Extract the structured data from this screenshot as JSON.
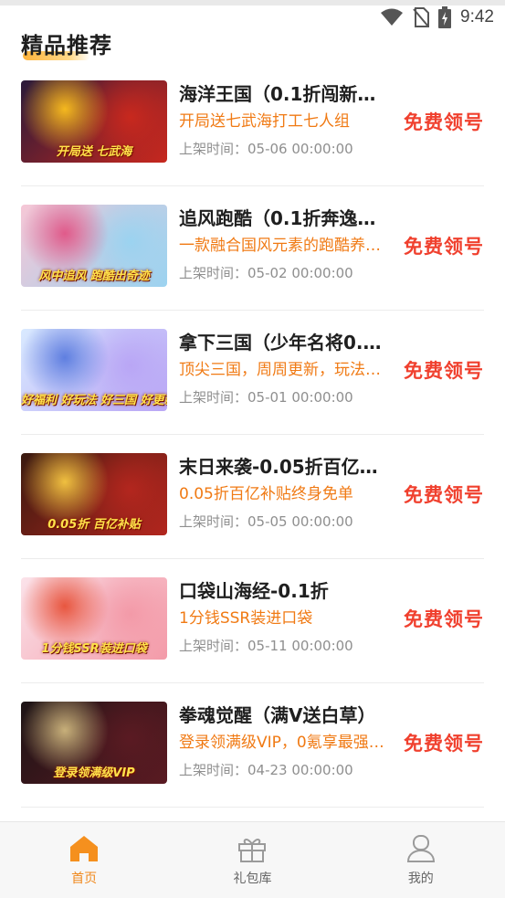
{
  "status_bar": {
    "time": "9:42",
    "icons": [
      "wifi-icon",
      "no-sim-icon",
      "battery-charging-icon"
    ]
  },
  "section": {
    "title": "精品推荐"
  },
  "items": [
    {
      "title": "海洋王国（0.1折闯新…",
      "desc": "开局送七武海打工七人组",
      "time": "上架时间：05-06 00:00:00",
      "claim": "免费领号",
      "thumb_caption": "开局送 七武海",
      "thumb_colors": [
        "#2a1a3a",
        "#c8281e",
        "#f5b91e"
      ]
    },
    {
      "title": "追风跑酷（0.1折奔逸…",
      "desc": "一款融合国风元素的跑酷养…",
      "time": "上架时间：05-02 00:00:00",
      "claim": "免费领号",
      "thumb_caption": "风中追风 跑酷出奇迹",
      "thumb_colors": [
        "#f6c7d6",
        "#9bd3f0",
        "#e05a8a"
      ]
    },
    {
      "title": "拿下三国（少年名将0.…",
      "desc": "顶尖三国，周周更新，玩法…",
      "time": "上架时间：05-01 00:00:00",
      "claim": "免费领号",
      "thumb_caption": "好福利 好玩法 好三国 好更新",
      "thumb_colors": [
        "#d9eaff",
        "#b9a6f5",
        "#5f7fe0"
      ]
    },
    {
      "title": "末日来袭-0.05折百亿…",
      "desc": "0.05折百亿补贴终身免单",
      "time": "上架时间：05-05 00:00:00",
      "claim": "免费领号",
      "thumb_caption": "0.05折 百亿补贴",
      "thumb_colors": [
        "#3a1a10",
        "#b3261e",
        "#f0c040"
      ]
    },
    {
      "title": "口袋山海经-0.1折",
      "desc": "1分钱SSR装进口袋",
      "time": "上架时间：05-11 00:00:00",
      "claim": "免费领号",
      "thumb_caption": "1分钱SSR装进口袋",
      "thumb_colors": [
        "#fbe3ea",
        "#f39aa8",
        "#e8563f"
      ]
    },
    {
      "title": "拳魂觉醒（满V送白草）",
      "desc": "登录领满级VIP，0氪享最强…",
      "time": "上架时间：04-23 00:00:00",
      "claim": "免费领号",
      "thumb_caption": "登录领满级VIP",
      "thumb_colors": [
        "#1d1416",
        "#5a1a22",
        "#c8b07a"
      ]
    }
  ],
  "nav": [
    {
      "label": "首页",
      "icon": "home-icon",
      "active": true
    },
    {
      "label": "礼包库",
      "icon": "gift-icon",
      "active": false
    },
    {
      "label": "我的",
      "icon": "profile-icon",
      "active": false
    }
  ],
  "colors": {
    "accent": "#f0891e",
    "claim": "#f0402e",
    "desc": "#f07a14"
  }
}
